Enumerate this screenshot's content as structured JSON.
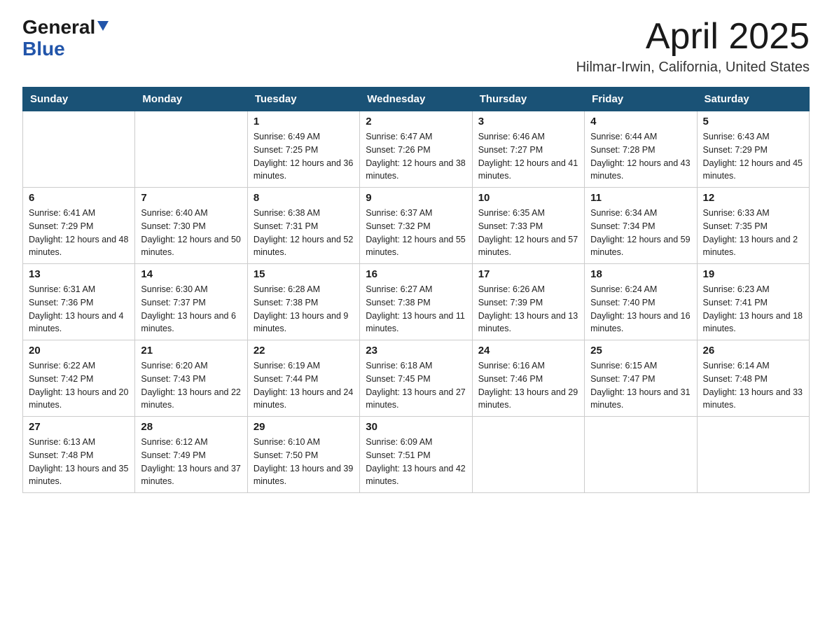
{
  "header": {
    "logo_general": "General",
    "logo_blue": "Blue",
    "title": "April 2025",
    "location": "Hilmar-Irwin, California, United States"
  },
  "weekdays": [
    "Sunday",
    "Monday",
    "Tuesday",
    "Wednesday",
    "Thursday",
    "Friday",
    "Saturday"
  ],
  "weeks": [
    [
      {
        "day": "",
        "sunrise": "",
        "sunset": "",
        "daylight": ""
      },
      {
        "day": "",
        "sunrise": "",
        "sunset": "",
        "daylight": ""
      },
      {
        "day": "1",
        "sunrise": "Sunrise: 6:49 AM",
        "sunset": "Sunset: 7:25 PM",
        "daylight": "Daylight: 12 hours and 36 minutes."
      },
      {
        "day": "2",
        "sunrise": "Sunrise: 6:47 AM",
        "sunset": "Sunset: 7:26 PM",
        "daylight": "Daylight: 12 hours and 38 minutes."
      },
      {
        "day": "3",
        "sunrise": "Sunrise: 6:46 AM",
        "sunset": "Sunset: 7:27 PM",
        "daylight": "Daylight: 12 hours and 41 minutes."
      },
      {
        "day": "4",
        "sunrise": "Sunrise: 6:44 AM",
        "sunset": "Sunset: 7:28 PM",
        "daylight": "Daylight: 12 hours and 43 minutes."
      },
      {
        "day": "5",
        "sunrise": "Sunrise: 6:43 AM",
        "sunset": "Sunset: 7:29 PM",
        "daylight": "Daylight: 12 hours and 45 minutes."
      }
    ],
    [
      {
        "day": "6",
        "sunrise": "Sunrise: 6:41 AM",
        "sunset": "Sunset: 7:29 PM",
        "daylight": "Daylight: 12 hours and 48 minutes."
      },
      {
        "day": "7",
        "sunrise": "Sunrise: 6:40 AM",
        "sunset": "Sunset: 7:30 PM",
        "daylight": "Daylight: 12 hours and 50 minutes."
      },
      {
        "day": "8",
        "sunrise": "Sunrise: 6:38 AM",
        "sunset": "Sunset: 7:31 PM",
        "daylight": "Daylight: 12 hours and 52 minutes."
      },
      {
        "day": "9",
        "sunrise": "Sunrise: 6:37 AM",
        "sunset": "Sunset: 7:32 PM",
        "daylight": "Daylight: 12 hours and 55 minutes."
      },
      {
        "day": "10",
        "sunrise": "Sunrise: 6:35 AM",
        "sunset": "Sunset: 7:33 PM",
        "daylight": "Daylight: 12 hours and 57 minutes."
      },
      {
        "day": "11",
        "sunrise": "Sunrise: 6:34 AM",
        "sunset": "Sunset: 7:34 PM",
        "daylight": "Daylight: 12 hours and 59 minutes."
      },
      {
        "day": "12",
        "sunrise": "Sunrise: 6:33 AM",
        "sunset": "Sunset: 7:35 PM",
        "daylight": "Daylight: 13 hours and 2 minutes."
      }
    ],
    [
      {
        "day": "13",
        "sunrise": "Sunrise: 6:31 AM",
        "sunset": "Sunset: 7:36 PM",
        "daylight": "Daylight: 13 hours and 4 minutes."
      },
      {
        "day": "14",
        "sunrise": "Sunrise: 6:30 AM",
        "sunset": "Sunset: 7:37 PM",
        "daylight": "Daylight: 13 hours and 6 minutes."
      },
      {
        "day": "15",
        "sunrise": "Sunrise: 6:28 AM",
        "sunset": "Sunset: 7:38 PM",
        "daylight": "Daylight: 13 hours and 9 minutes."
      },
      {
        "day": "16",
        "sunrise": "Sunrise: 6:27 AM",
        "sunset": "Sunset: 7:38 PM",
        "daylight": "Daylight: 13 hours and 11 minutes."
      },
      {
        "day": "17",
        "sunrise": "Sunrise: 6:26 AM",
        "sunset": "Sunset: 7:39 PM",
        "daylight": "Daylight: 13 hours and 13 minutes."
      },
      {
        "day": "18",
        "sunrise": "Sunrise: 6:24 AM",
        "sunset": "Sunset: 7:40 PM",
        "daylight": "Daylight: 13 hours and 16 minutes."
      },
      {
        "day": "19",
        "sunrise": "Sunrise: 6:23 AM",
        "sunset": "Sunset: 7:41 PM",
        "daylight": "Daylight: 13 hours and 18 minutes."
      }
    ],
    [
      {
        "day": "20",
        "sunrise": "Sunrise: 6:22 AM",
        "sunset": "Sunset: 7:42 PM",
        "daylight": "Daylight: 13 hours and 20 minutes."
      },
      {
        "day": "21",
        "sunrise": "Sunrise: 6:20 AM",
        "sunset": "Sunset: 7:43 PM",
        "daylight": "Daylight: 13 hours and 22 minutes."
      },
      {
        "day": "22",
        "sunrise": "Sunrise: 6:19 AM",
        "sunset": "Sunset: 7:44 PM",
        "daylight": "Daylight: 13 hours and 24 minutes."
      },
      {
        "day": "23",
        "sunrise": "Sunrise: 6:18 AM",
        "sunset": "Sunset: 7:45 PM",
        "daylight": "Daylight: 13 hours and 27 minutes."
      },
      {
        "day": "24",
        "sunrise": "Sunrise: 6:16 AM",
        "sunset": "Sunset: 7:46 PM",
        "daylight": "Daylight: 13 hours and 29 minutes."
      },
      {
        "day": "25",
        "sunrise": "Sunrise: 6:15 AM",
        "sunset": "Sunset: 7:47 PM",
        "daylight": "Daylight: 13 hours and 31 minutes."
      },
      {
        "day": "26",
        "sunrise": "Sunrise: 6:14 AM",
        "sunset": "Sunset: 7:48 PM",
        "daylight": "Daylight: 13 hours and 33 minutes."
      }
    ],
    [
      {
        "day": "27",
        "sunrise": "Sunrise: 6:13 AM",
        "sunset": "Sunset: 7:48 PM",
        "daylight": "Daylight: 13 hours and 35 minutes."
      },
      {
        "day": "28",
        "sunrise": "Sunrise: 6:12 AM",
        "sunset": "Sunset: 7:49 PM",
        "daylight": "Daylight: 13 hours and 37 minutes."
      },
      {
        "day": "29",
        "sunrise": "Sunrise: 6:10 AM",
        "sunset": "Sunset: 7:50 PM",
        "daylight": "Daylight: 13 hours and 39 minutes."
      },
      {
        "day": "30",
        "sunrise": "Sunrise: 6:09 AM",
        "sunset": "Sunset: 7:51 PM",
        "daylight": "Daylight: 13 hours and 42 minutes."
      },
      {
        "day": "",
        "sunrise": "",
        "sunset": "",
        "daylight": ""
      },
      {
        "day": "",
        "sunrise": "",
        "sunset": "",
        "daylight": ""
      },
      {
        "day": "",
        "sunrise": "",
        "sunset": "",
        "daylight": ""
      }
    ]
  ]
}
